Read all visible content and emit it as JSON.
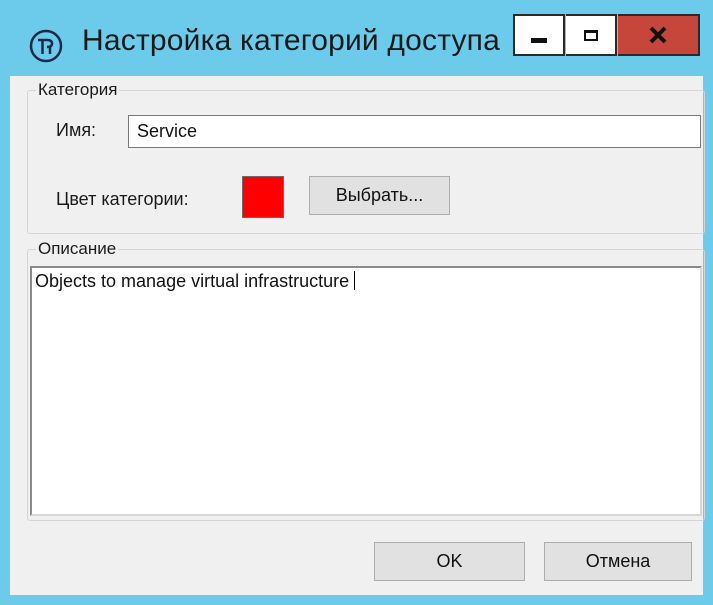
{
  "window": {
    "title": "Настройка категорий доступа",
    "icon": "app-logo-icon"
  },
  "titlebar_buttons": {
    "minimize": "minimize-icon",
    "maximize": "maximize-icon",
    "close_glyph": "x"
  },
  "category_group": {
    "legend": "Категория",
    "name_label": "Имя:",
    "name_value": "Service",
    "color_label": "Цвет категории:",
    "color_value": "#ff0000",
    "choose_button": "Выбрать..."
  },
  "description_group": {
    "legend": "Описание",
    "text": "Objects to manage virtual infrastructure"
  },
  "footer": {
    "ok_label": "OK",
    "cancel_label": "Отмена"
  },
  "colors": {
    "window_frame": "#6ccbea",
    "close_button": "#c7463b",
    "dialog_background": "#f0f0f0"
  }
}
